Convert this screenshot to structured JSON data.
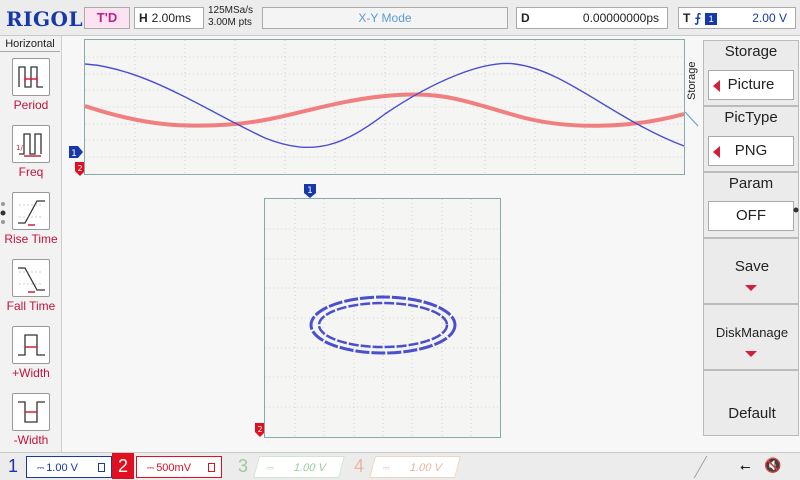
{
  "brand": "RIGOL",
  "top": {
    "trigger_status": "T'D",
    "horizontal_key": "H",
    "timebase": "2.00ms",
    "sample_rate": "125MSa/s",
    "memory_depth": "3.00M pts",
    "mode": "X-Y Mode",
    "delay_key": "D",
    "delay": "0.00000000ps",
    "trigger_key": "T",
    "trigger_source": "1",
    "trigger_level": "2.00 V"
  },
  "left_menu": {
    "title": "Horizontal",
    "items": [
      {
        "label": "Period",
        "icon": "period-icon"
      },
      {
        "label": "Freq",
        "icon": "freq-icon"
      },
      {
        "label": "Rise Time",
        "icon": "rise-time-icon"
      },
      {
        "label": "Fall Time",
        "icon": "fall-time-icon"
      },
      {
        "label": "+Width",
        "icon": "pos-width-icon"
      },
      {
        "label": "-Width",
        "icon": "neg-width-icon"
      }
    ]
  },
  "right_menu": {
    "side_label": "Storage",
    "storage": {
      "title": "Storage",
      "value": "Picture"
    },
    "pictype": {
      "title": "PicType",
      "value": "PNG"
    },
    "param": {
      "title": "Param",
      "value": "OFF"
    },
    "save": "Save",
    "disk_manage": "DiskManage",
    "default": "Default"
  },
  "markers": {
    "trigger_pos": "T",
    "ch1": "1",
    "ch2": "2"
  },
  "channels": [
    {
      "num": "1",
      "scale": "1.00 V",
      "color": "#1638a8"
    },
    {
      "num": "2",
      "scale": "500mV",
      "color": "#e01020"
    },
    {
      "num": "3",
      "scale": "1.00 V",
      "color": "#9ccc9c"
    },
    {
      "num": "4",
      "scale": "1.00 V",
      "color": "#e8b89a"
    }
  ],
  "colors": {
    "ch1": "#4a4fd0",
    "ch2": "#f06a6a",
    "grid": "#c8c8c8",
    "accent": "#d0203a"
  }
}
